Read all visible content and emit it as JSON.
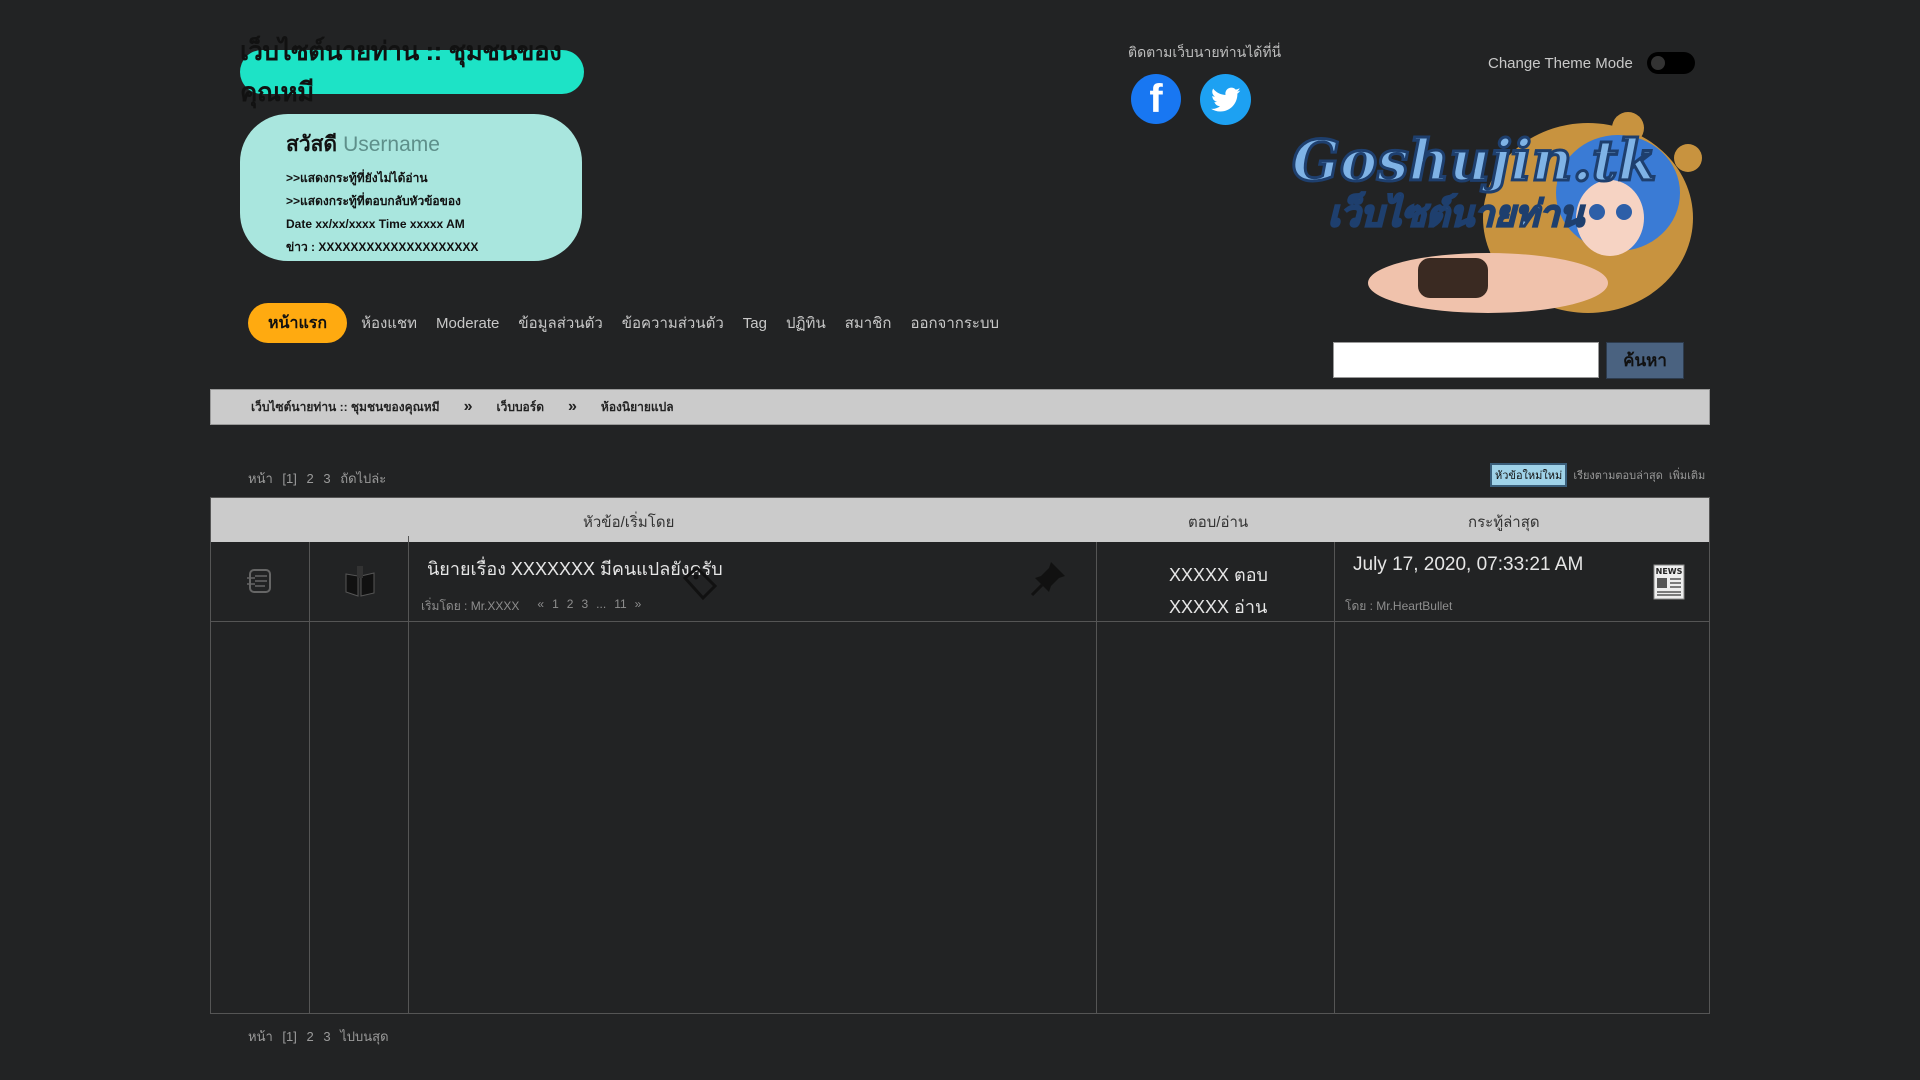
{
  "header": {
    "site_title": "เว็บไซต์นายท่าน :: ชุมชนของคุณหมี",
    "greeting": "สวัสดี",
    "username": "Username",
    "links": [
      ">>แสดงกระทู้ที่ยังไม่ได้อ่าน",
      ">>แสดงกระทู้ที่ตอบกลับหัวข้อของ"
    ],
    "datetime": "Date xx/xx/xxxx Time xxxxx AM",
    "news": "ข่าว : XXXXXXXXXXXXXXXXXXXX",
    "social_caption": "ติดตามเว็บนายท่านได้ที่นี่",
    "theme_label": "Change Theme Mode",
    "banner_text": "Goshujin.tk",
    "banner_sub": "เว็บไซต์นายท่าน",
    "search_button": "ค้นหา"
  },
  "nav": {
    "home": "หน้าแรก",
    "items": [
      "ห้องแชท",
      "Moderate",
      "ข้อมูลส่วนตัว",
      "ข้อความส่วนตัว",
      "Tag",
      "ปฏิทิน",
      "สมาชิก",
      "ออกจากระบบ"
    ]
  },
  "breadcrumb": [
    "เว็บไซต์นายท่าน :: ชุมชนของคุณหมี",
    "เว็บบอร์ด",
    "ห้องนิยายแปล"
  ],
  "pagination": {
    "top": [
      "หน้า",
      "[1]",
      "2",
      "3",
      "ถัดไปล่ะ"
    ],
    "bottom": [
      "หน้า",
      "[1]",
      "2",
      "3",
      "ไปบนสุด"
    ]
  },
  "sort_options": [
    "หัวข้อใหม่ใหม่",
    "เรียงตามตอบล่าสุด",
    "เพิ่มเติม"
  ],
  "table": {
    "headers": [
      "หัวข้อ/เริ่มโดย",
      "ตอบ/อ่าน",
      "กระทู้ล่าสุด"
    ],
    "rows": [
      {
        "title": "นิยายเรื่อง XXXXXXX มีคนแปลยังครับ",
        "started_by": "เริ่มโดย : Mr.XXXX",
        "pages": [
          "«",
          "1",
          "2",
          "3",
          "...",
          "11",
          "»"
        ],
        "replies": "XXXXX ตอบ",
        "views": "XXXXX อ่าน",
        "last_date": "July 17, 2020, 07:33:21 AM",
        "last_by": "โดย : Mr.HeartBullet",
        "news_icon_label": "NEWS"
      }
    ]
  }
}
